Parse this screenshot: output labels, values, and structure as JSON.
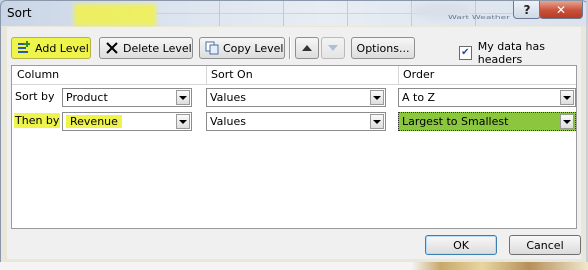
{
  "window": {
    "title": "Sort",
    "help_label": "?",
    "close_label": "✕"
  },
  "toolbar": {
    "add_level_label": "Add Level",
    "delete_level_label": "Delete Level",
    "copy_level_label": "Copy Level",
    "options_label": "Options...",
    "my_data_has_headers_label": "My data has headers",
    "my_data_has_headers_checked": true
  },
  "columns": {
    "column": "Column",
    "sort_on": "Sort On",
    "order": "Order"
  },
  "rows": [
    {
      "label": "Sort by",
      "column": "Product",
      "sort_on": "Values",
      "order": "A to Z"
    },
    {
      "label": "Then by",
      "column": "Revenue",
      "sort_on": "Values",
      "order": "Largest to Smallest"
    }
  ],
  "buttons": {
    "ok_label": "OK",
    "cancel_label": "Cancel"
  },
  "background_text": "Wart Weather",
  "colors": {
    "highlight": "#eef44a",
    "order_cell_green": "#8cc63f"
  }
}
